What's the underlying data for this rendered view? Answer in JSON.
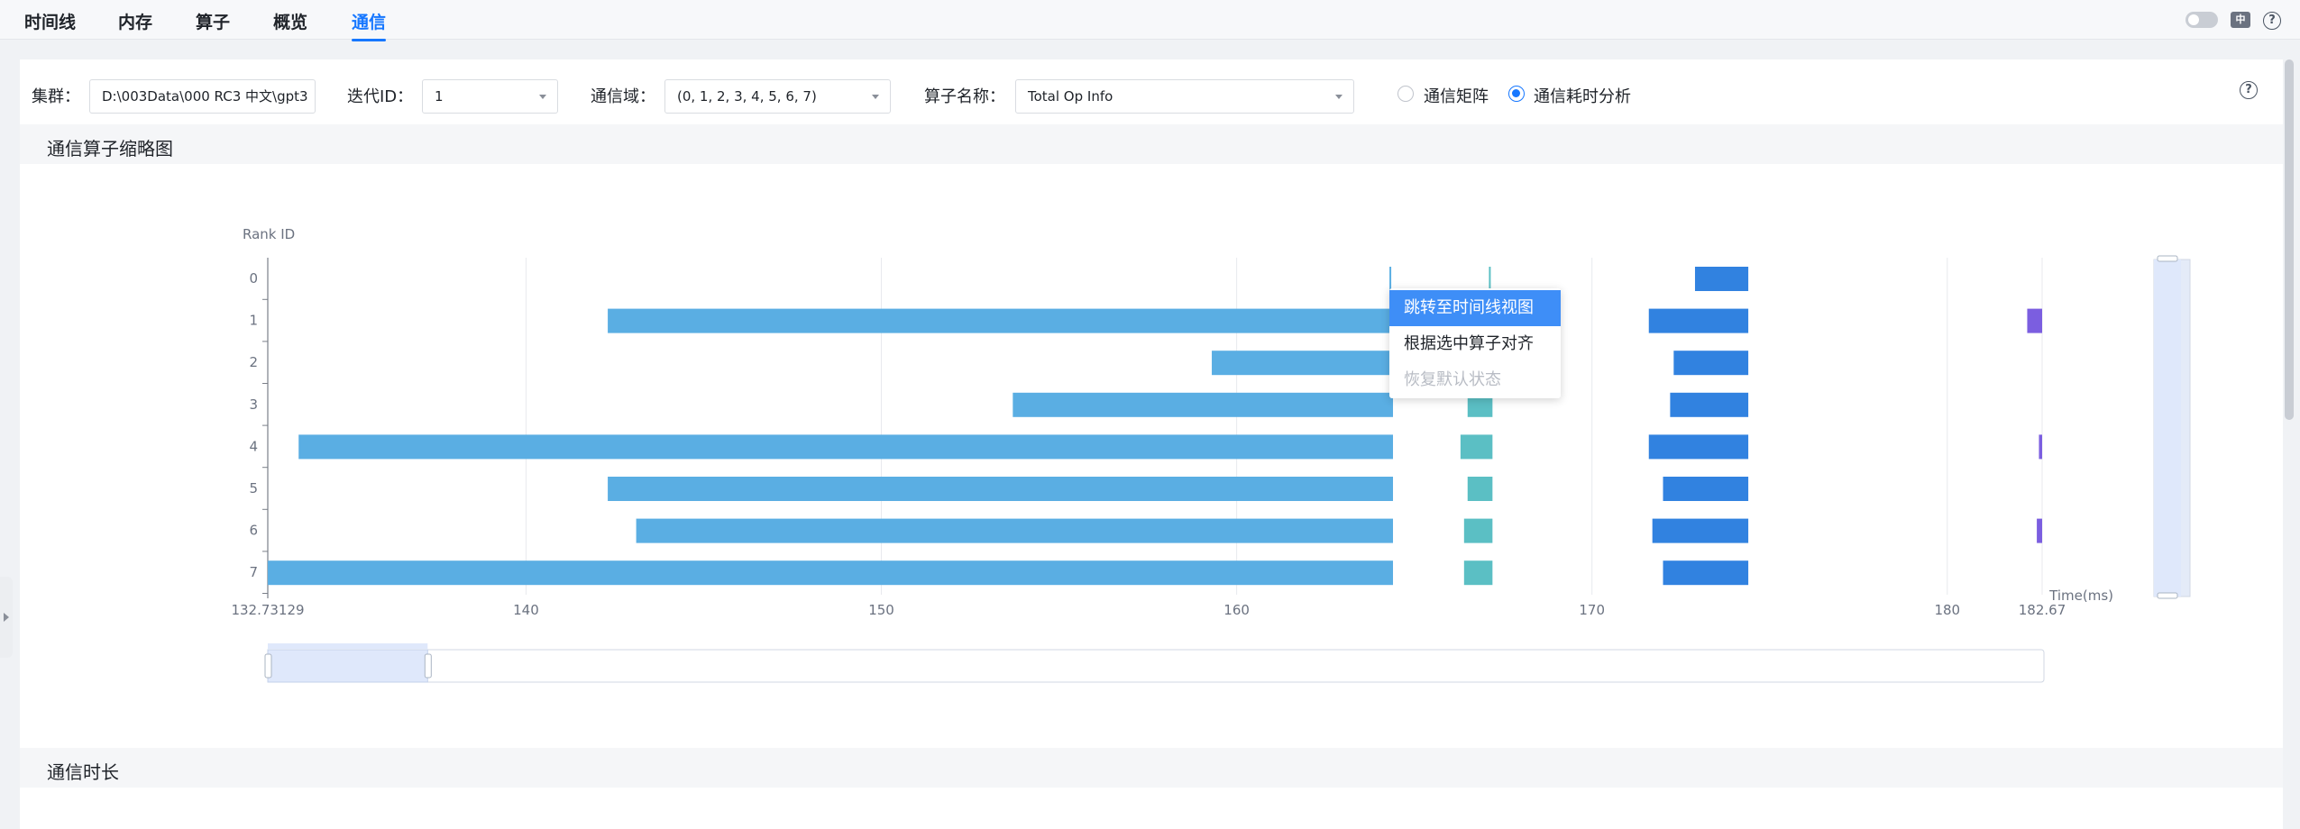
{
  "tabs": [
    {
      "label": "时间线"
    },
    {
      "label": "内存"
    },
    {
      "label": "算子"
    },
    {
      "label": "概览"
    },
    {
      "label": "通信"
    }
  ],
  "active_tab": "通信",
  "header_icons": {
    "theme_toggle": "toggle-switch-icon",
    "language": "language-switch-icon",
    "language_glyph": "中",
    "help": "help-icon",
    "help_glyph": "?"
  },
  "filters": {
    "cluster": {
      "label": "集群：",
      "value": "D:\\003Data\\000 RC3 中文\\gpt3"
    },
    "iteration": {
      "label": "迭代ID：",
      "value": "1"
    },
    "comm_domain": {
      "label": "通信域：",
      "value": "(0, 1, 2, 3, 4, 5, 6, 7)"
    },
    "operator_name": {
      "label": "算子名称：",
      "value": "Total Op Info"
    },
    "mode_options": [
      {
        "label": "通信矩阵",
        "checked": false
      },
      {
        "label": "通信耗时分析",
        "checked": true
      }
    ],
    "help_glyph": "?"
  },
  "sections": {
    "thumbnail_title": "通信算子缩略图",
    "duration_title": "通信时长"
  },
  "context_menu": {
    "items": [
      {
        "label": "跳转至时间线视图",
        "state": "hover"
      },
      {
        "label": "根据选中算子对齐",
        "state": "normal"
      },
      {
        "label": "恢复默认状态",
        "state": "disabled"
      }
    ]
  },
  "colors": {
    "accent": "#1677ff",
    "bar_light_blue": "#5aaee3",
    "bar_teal": "#5bbfc4",
    "bar_blue": "#3182e0",
    "bar_purple": "#7b5ee0"
  },
  "chart_data": {
    "type": "bar",
    "orientation": "horizontal-ranges",
    "ylabel": "Rank ID",
    "xlabel": "Time(ms)",
    "categories": [
      "0",
      "1",
      "2",
      "3",
      "4",
      "5",
      "6",
      "7"
    ],
    "x_ticks": [
      "132.73129",
      "140",
      "150",
      "160",
      "170",
      "180",
      "182.67"
    ],
    "x_tick_values": [
      132.73129,
      140,
      150,
      160,
      170,
      180,
      182.67
    ],
    "xlim": [
      132.73129,
      182.67
    ],
    "grid": "vertical",
    "series": [
      {
        "color": "#5aaee3",
        "ranges": [
          [
            0,
            164.3,
            164.35
          ],
          [
            1,
            142.3,
            164.4
          ],
          [
            2,
            159.3,
            164.4
          ],
          [
            3,
            153.7,
            164.4
          ],
          [
            4,
            133.6,
            164.4
          ],
          [
            5,
            142.3,
            164.4
          ],
          [
            6,
            143.1,
            164.4
          ],
          [
            7,
            132.73,
            164.4
          ]
        ]
      },
      {
        "color": "#5bbfc4",
        "ranges": [
          [
            0,
            167.1,
            167.15
          ],
          [
            1,
            166.5,
            167.2
          ],
          [
            2,
            166.5,
            167.2
          ],
          [
            3,
            166.5,
            167.2
          ],
          [
            4,
            166.3,
            167.2
          ],
          [
            5,
            166.5,
            167.2
          ],
          [
            6,
            166.4,
            167.2
          ],
          [
            7,
            166.4,
            167.2
          ]
        ]
      },
      {
        "color": "#3182e0",
        "ranges": [
          [
            0,
            172.9,
            174.4
          ],
          [
            1,
            171.6,
            174.4
          ],
          [
            2,
            172.3,
            174.4
          ],
          [
            3,
            172.2,
            174.4
          ],
          [
            4,
            171.6,
            174.4
          ],
          [
            5,
            172.0,
            174.4
          ],
          [
            6,
            171.7,
            174.4
          ],
          [
            7,
            172.0,
            174.4
          ]
        ]
      },
      {
        "color": "#7b5ee0",
        "ranges": [
          [
            1,
            182.25,
            182.67
          ],
          [
            4,
            182.58,
            182.67
          ],
          [
            6,
            182.52,
            182.67
          ]
        ]
      }
    ],
    "zoom_window": [
      0,
      0.09
    ]
  }
}
